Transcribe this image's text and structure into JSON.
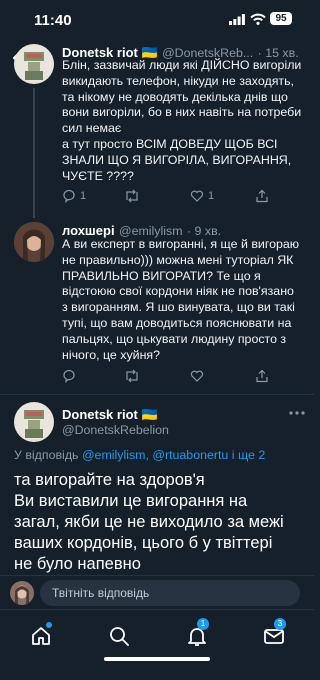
{
  "status": {
    "time": "11:40",
    "battery": "95"
  },
  "tweets": [
    {
      "name": "Donetsk riot 🇺🇦",
      "handle": "@DonetskReb...",
      "time": "· 15 хв.",
      "lines": [
        "Блін, зазвичай люди які ДІЙСНО вигоріли",
        "викидають телефон, нікуди не заходять,",
        "та нікому не доводять декілька днів що",
        "вони вигоріли, бо в них навіть на потреби",
        "сил немає",
        "а тут просто ВСІМ ДОВЕДУ ЩОБ ВСІ",
        "ЗНАЛИ ЩО Я ВИГОРІЛА, ВИГОРАННЯ,",
        "ЧУЄТЕ ????"
      ],
      "reply_count": "1",
      "retweet_count": "",
      "like_count": "1"
    },
    {
      "name": "лохшері",
      "handle": "@emilylism",
      "time": "· 9 хв.",
      "lines": [
        "А ви експерт в вигоранні, я ще й вигораю",
        "не правильно))) можна мені туторіал ЯК",
        "ПРАВИЛЬНО ВИГОРАТИ? Те що я",
        "відстоюю свої кордони ніяк не пов'язано",
        "з вигоранням. Я шо винувата, що ви такі",
        "тупі, що вам доводиться пояснювати на",
        "пальцях, що цькувати людину просто з",
        "нічого, це хуйня?"
      ],
      "reply_count": "",
      "retweet_count": "",
      "like_count": ""
    }
  ],
  "main_tweet": {
    "name": "Donetsk riot 🇺🇦",
    "handle": "@DonetskRebelion",
    "reply_prefix": "У відповідь",
    "reply_users": "@emilylism, @rtuabonertu і ще 2",
    "lines": [
      "та вигорайте на здоров'я",
      "Ви виставили це вигорання на",
      "загал, якби це не виходило за межі",
      "ваших кордонів, цього б у твіттері",
      "не було напевно"
    ]
  },
  "reply_bar": {
    "placeholder": "Твітніть відповідь"
  },
  "nav": {
    "notifications_badge": "1",
    "messages_badge": "3"
  },
  "colors": {
    "background": "#15202b",
    "accent": "#1d9bf0",
    "muted": "#8b98a5"
  }
}
